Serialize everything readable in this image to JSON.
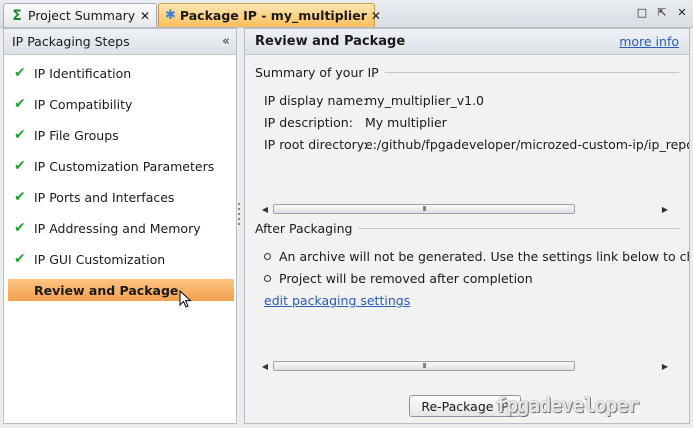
{
  "tabs": [
    {
      "label": "Project Summary",
      "icon": "sigma-icon",
      "active": false
    },
    {
      "label": "Package IP - my_multiplier",
      "icon": "package-icon",
      "active": true
    }
  ],
  "window_controls": {
    "restore": "□",
    "maximize": "⇱",
    "close": "✕"
  },
  "left_panel": {
    "title": "IP Packaging Steps",
    "collapse_glyph": "«",
    "steps": [
      {
        "label": "IP Identification",
        "checked": true
      },
      {
        "label": "IP Compatibility",
        "checked": true
      },
      {
        "label": "IP File Groups",
        "checked": true
      },
      {
        "label": "IP Customization Parameters",
        "checked": true
      },
      {
        "label": "IP Ports and Interfaces",
        "checked": true
      },
      {
        "label": "IP Addressing and Memory",
        "checked": true
      },
      {
        "label": "IP GUI Customization",
        "checked": true
      },
      {
        "label": "Review and Package",
        "checked": false,
        "selected": true
      }
    ]
  },
  "right_panel": {
    "title": "Review and Package",
    "more_info": "more info",
    "summary": {
      "heading": "Summary of your IP",
      "display_name_label": "IP display name:",
      "display_name_value": "my_multiplier_v1.0",
      "description_label": "IP description:",
      "description_value": "My multiplier",
      "root_dir_label": "IP root directory:",
      "root_dir_value": "e:/github/fpgadeveloper/microzed-custom-ip/ip_repo/"
    },
    "after": {
      "heading": "After Packaging",
      "bullets": [
        "An archive will not be generated. Use the settings link below to chang",
        "Project will be removed after completion"
      ],
      "edit_link": "edit packaging settings"
    },
    "repackage_button": "Re-Package IP",
    "scroll_thumb_glyph": "III"
  },
  "watermark": "fpgadeveloper"
}
